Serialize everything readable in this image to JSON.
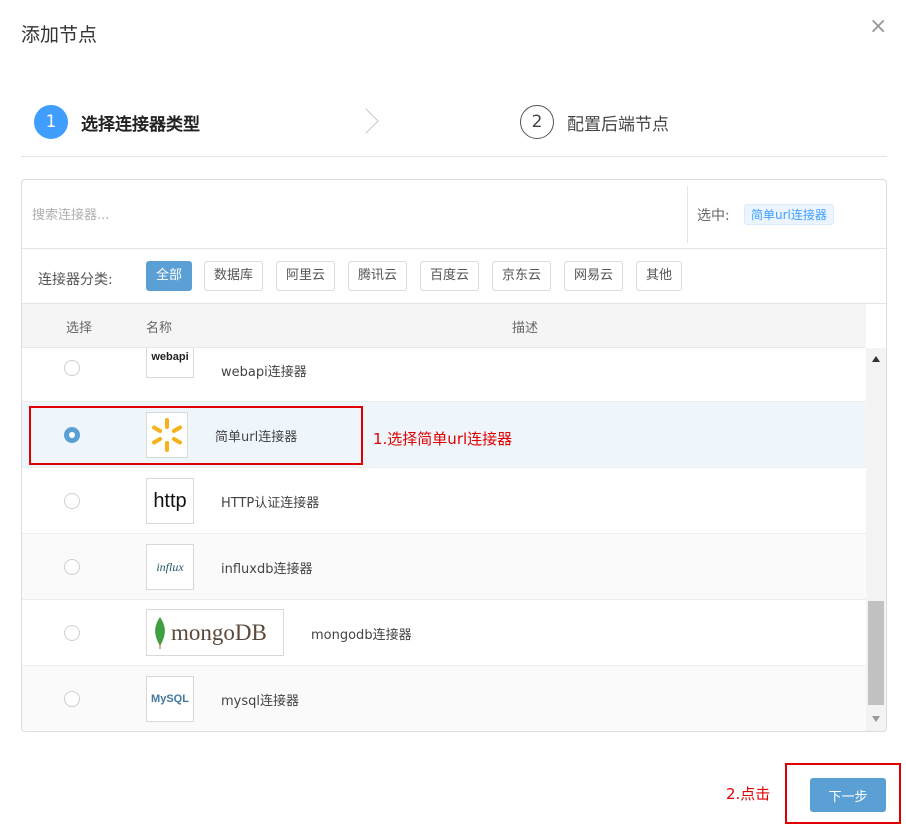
{
  "dialog": {
    "title": "添加节点",
    "close_glyph": "×"
  },
  "steps": [
    {
      "number": "1",
      "label": "选择连接器类型",
      "state": "active"
    },
    {
      "number": "2",
      "label": "配置后端节点",
      "state": "pending"
    }
  ],
  "search": {
    "placeholder": "搜索连接器...",
    "value": ""
  },
  "selection": {
    "label": "选中:",
    "selected": "简单url连接器"
  },
  "categories": {
    "label": "连接器分类:",
    "items": [
      "全部",
      "数据库",
      "阿里云",
      "腾讯云",
      "百度云",
      "京东云",
      "网易云",
      "其他"
    ],
    "active": "全部"
  },
  "table": {
    "headers": {
      "select": "选择",
      "name": "名称",
      "description": "描述"
    },
    "rows": [
      {
        "logo_text": "webapi",
        "name": "webapi连接器",
        "selected": false
      },
      {
        "logo_icon": "sunburst-icon",
        "name": "简单url连接器",
        "selected": true
      },
      {
        "logo_text": "http",
        "name": "HTTP认证连接器",
        "selected": false
      },
      {
        "logo_text": "influx",
        "name": "influxdb连接器",
        "selected": false
      },
      {
        "logo_text": "mongoDB",
        "name": "mongodb连接器",
        "selected": false
      },
      {
        "logo_text": "MySQL",
        "name": "mysql连接器",
        "selected": false
      }
    ]
  },
  "annotations": {
    "step1": "1.选择简单url连接器",
    "step2": "2.点击",
    "color": "#e00000"
  },
  "footer": {
    "next_label": "下一步"
  },
  "colors": {
    "accent": "#409eff",
    "primary_button": "#5ba0d5",
    "selected_row": "#eef6fc"
  }
}
